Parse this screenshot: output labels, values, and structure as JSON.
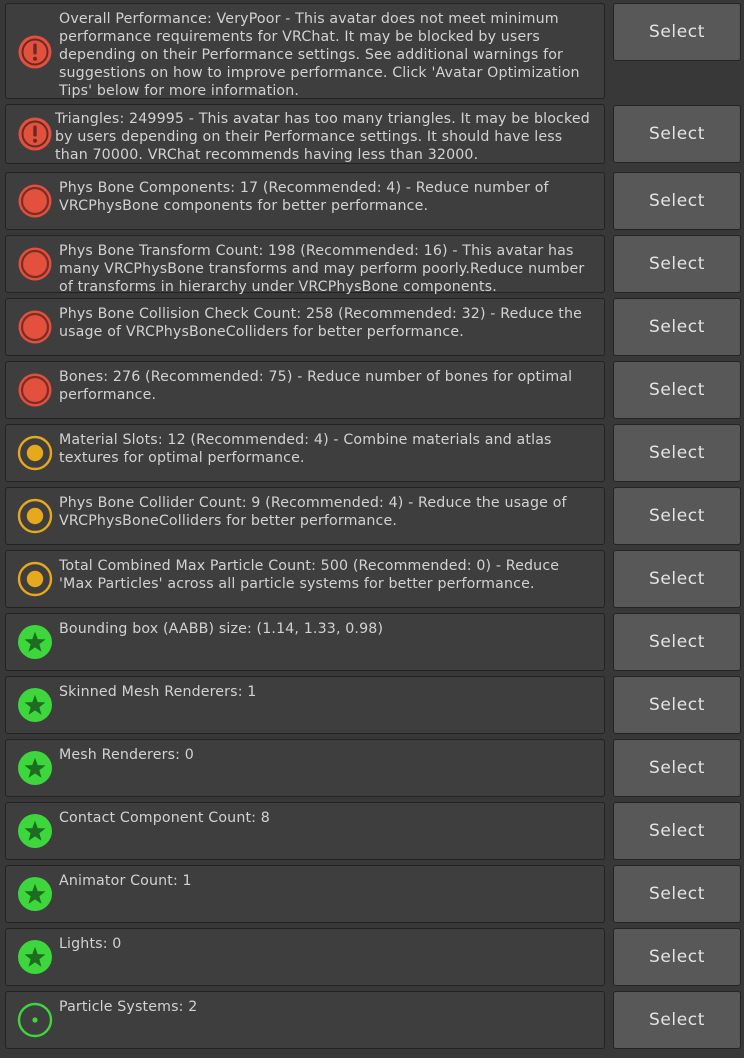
{
  "select_label": "Select",
  "colors": {
    "error": "#e3503e",
    "warning": "#e7a81b",
    "good": "#3dd63d"
  },
  "items": [
    {
      "severity": "error-warning",
      "icon": "exclamation-icon",
      "text": "Overall Performance: VeryPoor - This avatar does not meet minimum performance requirements for VRChat. It may be blocked by users depending on their Performance settings. See additional warnings for suggestions on how to improve performance. Click 'Avatar Optimization Tips' below for more information."
    },
    {
      "severity": "error-warning",
      "icon": "exclamation-icon",
      "text": "Triangles: 249995 - This avatar has too many triangles. It may be blocked by users depending on their Performance settings. It should have less than 70000. VRChat recommends having less than 32000."
    },
    {
      "severity": "error",
      "icon": "red-circle-icon",
      "text": "Phys Bone Components: 17 (Recommended: 4) - Reduce number of VRCPhysBone components for better performance."
    },
    {
      "severity": "error",
      "icon": "red-circle-icon",
      "text": "Phys Bone Transform Count: 198 (Recommended: 16) - This avatar has many VRCPhysBone transforms and may perform poorly.Reduce number of transforms in hierarchy under VRCPhysBone components."
    },
    {
      "severity": "error",
      "icon": "red-circle-icon",
      "text": "Phys Bone Collision Check Count: 258 (Recommended: 32) - Reduce the usage of VRCPhysBoneColliders for better performance."
    },
    {
      "severity": "error",
      "icon": "red-circle-icon",
      "text": "Bones: 276 (Recommended: 75) - Reduce number of bones for optimal performance."
    },
    {
      "severity": "warning",
      "icon": "yellow-circle-icon",
      "text": "Material Slots: 12 (Recommended: 4) - Combine materials and atlas textures for optimal performance."
    },
    {
      "severity": "warning",
      "icon": "yellow-circle-icon",
      "text": "Phys Bone Collider Count: 9 (Recommended: 4) - Reduce the usage of VRCPhysBoneColliders for better performance."
    },
    {
      "severity": "warning",
      "icon": "yellow-circle-icon",
      "text": "Total Combined Max Particle Count: 500 (Recommended: 0) - Reduce 'Max Particles' across all particle systems for better performance."
    },
    {
      "severity": "good",
      "icon": "green-star-icon",
      "text": "Bounding box (AABB) size: (1.14, 1.33, 0.98)"
    },
    {
      "severity": "good",
      "icon": "green-star-icon",
      "text": "Skinned Mesh Renderers: 1"
    },
    {
      "severity": "good",
      "icon": "green-star-icon",
      "text": "Mesh Renderers: 0"
    },
    {
      "severity": "good",
      "icon": "green-star-icon",
      "text": "Contact Component Count: 8"
    },
    {
      "severity": "good",
      "icon": "green-star-icon",
      "text": "Animator Count: 1"
    },
    {
      "severity": "good",
      "icon": "green-star-icon",
      "text": "Lights: 0"
    },
    {
      "severity": "info",
      "icon": "green-dot-icon",
      "text": "Particle Systems: 2"
    }
  ]
}
